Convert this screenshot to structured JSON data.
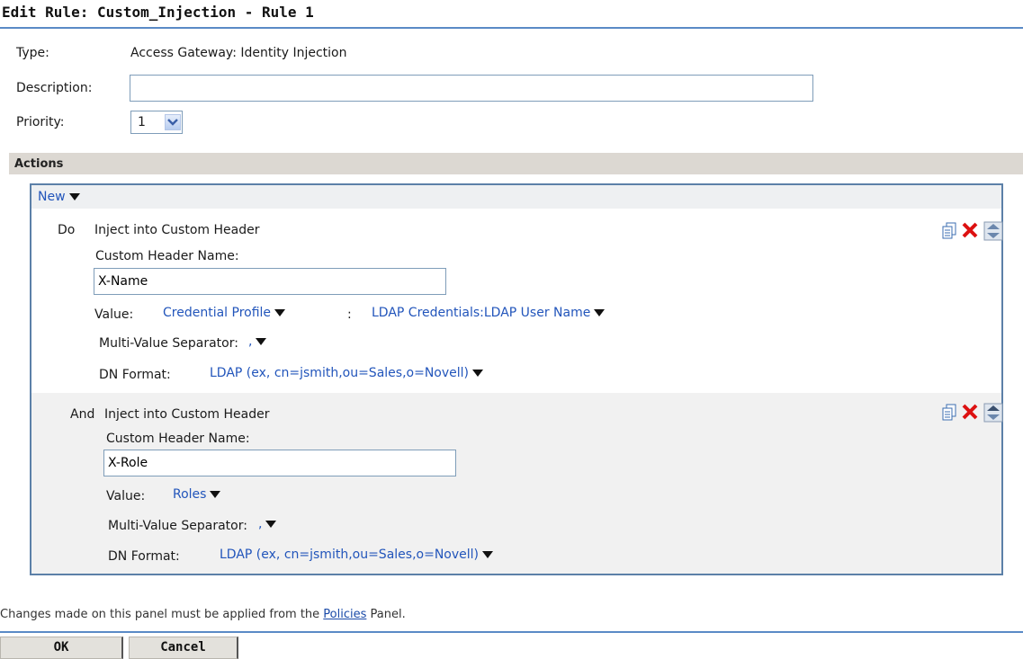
{
  "title": "Edit Rule: Custom_Injection - Rule 1",
  "form": {
    "type_label": "Type:",
    "type_value": "Access Gateway: Identity Injection",
    "description_label": "Description:",
    "description_value": "",
    "priority_label": "Priority:",
    "priority_value": "1"
  },
  "actions": {
    "section_label": "Actions",
    "new_label": "New",
    "items": [
      {
        "prefix": "Do",
        "title": "Inject into Custom Header",
        "header_name_label": "Custom Header Name:",
        "header_name_value": "X-Name",
        "value_label": "Value:",
        "value_type": "Credential Profile",
        "value_separator": ":",
        "value_detail": "LDAP Credentials:LDAP User Name",
        "multi_label": "Multi-Value Separator:",
        "multi_value": ",",
        "dn_label": "DN Format:",
        "dn_value": "LDAP (ex, cn=jsmith,ou=Sales,o=Novell)"
      },
      {
        "prefix": "And",
        "title": "Inject into Custom Header",
        "header_name_label": "Custom Header Name:",
        "header_name_value": "X-Role",
        "value_label": "Value:",
        "value_type": "Roles",
        "multi_label": "Multi-Value Separator:",
        "multi_value": ",",
        "dn_label": "DN Format:",
        "dn_value": "LDAP (ex, cn=jsmith,ou=Sales,o=Novell)"
      }
    ]
  },
  "footer": {
    "note_before": "Changes made on this panel must be applied from the ",
    "note_link": "Policies",
    "note_after": " Panel.",
    "ok_label": "OK",
    "cancel_label": "Cancel"
  },
  "colors": {
    "accent": "#5a8ac6",
    "link": "#2255bb",
    "section_bg": "#dcd8d2",
    "delete": "#dd1111"
  },
  "icons": [
    "copy-icon",
    "delete-icon",
    "move-up-down-icon",
    "dropdown-arrow-icon"
  ]
}
